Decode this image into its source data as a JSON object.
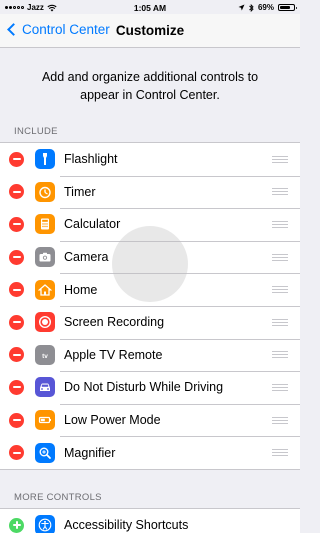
{
  "status_bar": {
    "carrier": "Jazz",
    "time": "1:05 AM",
    "battery": "69%",
    "battery_level": 0.69
  },
  "nav": {
    "back_label": "Control Center",
    "title": "Customize"
  },
  "description": "Add and organize additional controls to appear in Control Center.",
  "include": {
    "header": "INCLUDE",
    "items": [
      {
        "label": "Flashlight",
        "icon": "flashlight-icon",
        "color": "#007aff"
      },
      {
        "label": "Timer",
        "icon": "timer-icon",
        "color": "#ff9500"
      },
      {
        "label": "Calculator",
        "icon": "calculator-icon",
        "color": "#ff9500"
      },
      {
        "label": "Camera",
        "icon": "camera-icon",
        "color": "#8e8e93"
      },
      {
        "label": "Home",
        "icon": "home-icon",
        "color": "#ff9500"
      },
      {
        "label": "Screen Recording",
        "icon": "screen-recording-icon",
        "color": "#ff3b30"
      },
      {
        "label": "Apple TV Remote",
        "icon": "apple-tv-icon",
        "color": "#8e8e93"
      },
      {
        "label": "Do Not Disturb While Driving",
        "icon": "car-icon",
        "color": "#5856d6"
      },
      {
        "label": "Low Power Mode",
        "icon": "battery-icon",
        "color": "#ff9500"
      },
      {
        "label": "Magnifier",
        "icon": "magnifier-icon",
        "color": "#007aff"
      }
    ]
  },
  "more_controls": {
    "header": "MORE CONTROLS",
    "items": [
      {
        "label": "Accessibility Shortcuts",
        "icon": "accessibility-icon",
        "color": "#007aff"
      }
    ]
  }
}
